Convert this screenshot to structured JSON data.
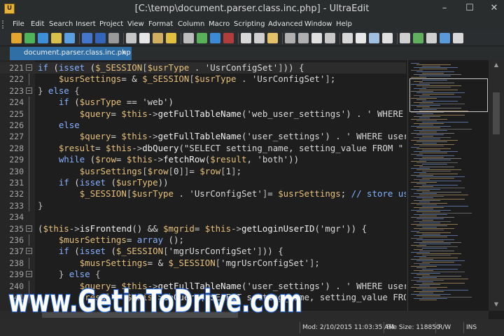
{
  "window": {
    "title": "[C:\\temp\\document.parser.class.inc.php] - UltraEdit",
    "minimize": "–",
    "maximize": "☐",
    "close": "✕"
  },
  "menu": [
    "File",
    "Edit",
    "Search",
    "Insert",
    "Project",
    "View",
    "Format",
    "Column",
    "Macro",
    "Scripting",
    "Advanced",
    "Window",
    "Help"
  ],
  "toolbar_icons": [
    "new-file-icon",
    "back-icon",
    "forward-icon",
    "folder-icon",
    "open-icon",
    "save-icon",
    "save-all-icon",
    "print-icon",
    "print-preview-icon",
    "settings-icon",
    "dictionary-icon",
    "column-mode-icon",
    "hex-icon",
    "ftp-icon",
    "globe-icon",
    "bookmark-icon",
    "cut-icon",
    "copy-icon",
    "paste-icon",
    "undo-icon",
    "redo-icon",
    "find-icon",
    "replace-icon",
    "find-files-icon",
    "zoom-icon",
    "list-icon",
    "window-icon",
    "compare-icon",
    "sync-icon",
    "theme-icon",
    "help-icon",
    "info-icon"
  ],
  "tabs": [
    {
      "label": "document.parser.class.inc.php",
      "close": "x"
    }
  ],
  "code": [
    {
      "n": "221",
      "fold": "-",
      "tokens": [
        [
          "k",
          "if"
        ],
        [
          "s",
          " ("
        ],
        [
          "k",
          "isset"
        ],
        [
          "s",
          " ("
        ],
        [
          "v",
          "$_SESSION"
        ],
        [
          "p",
          "["
        ],
        [
          "v",
          "$usrType"
        ],
        [
          "s",
          " . "
        ],
        [
          "s",
          "'UsrConfigSet'"
        ],
        [
          "p",
          "]"
        ],
        [
          "s",
          "))"
        ],
        [
          "s",
          " {"
        ]
      ]
    },
    {
      "n": "222",
      "fold": "|",
      "tokens": [
        [
          "s",
          "    "
        ],
        [
          "v",
          "$usrSettings"
        ],
        [
          "s",
          "= & "
        ],
        [
          "v",
          "$_SESSION"
        ],
        [
          "p",
          "["
        ],
        [
          "v",
          "$usrType"
        ],
        [
          "s",
          " . "
        ],
        [
          "s",
          "'UsrConfigSet'"
        ],
        [
          "p",
          "]"
        ],
        [
          "s",
          ";"
        ]
      ]
    },
    {
      "n": "223",
      "fold": "-",
      "tokens": [
        [
          "p",
          "} "
        ],
        [
          "k",
          "else"
        ],
        [
          "p",
          " {"
        ]
      ]
    },
    {
      "n": "224",
      "fold": "|",
      "tokens": [
        [
          "s",
          "    "
        ],
        [
          "k",
          "if"
        ],
        [
          "s",
          " ("
        ],
        [
          "v",
          "$usrType"
        ],
        [
          "s",
          " == "
        ],
        [
          "s",
          "'web'"
        ],
        [
          "s",
          ")"
        ]
      ]
    },
    {
      "n": "225",
      "fold": "|",
      "tokens": [
        [
          "s",
          "        "
        ],
        [
          "v",
          "$query"
        ],
        [
          "s",
          "= "
        ],
        [
          "v",
          "$this"
        ],
        [
          "p",
          "->"
        ],
        [
          "f",
          "getFullTableName"
        ],
        [
          "s",
          "("
        ],
        [
          "s",
          "'web_user_settings'"
        ],
        [
          "s",
          ") . "
        ],
        [
          "s",
          "' WHERE webus"
        ]
      ]
    },
    {
      "n": "226",
      "fold": "|",
      "tokens": [
        [
          "s",
          "    "
        ],
        [
          "k",
          "else"
        ]
      ]
    },
    {
      "n": "227",
      "fold": "|",
      "tokens": [
        [
          "s",
          "        "
        ],
        [
          "v",
          "$query"
        ],
        [
          "s",
          "= "
        ],
        [
          "v",
          "$this"
        ],
        [
          "p",
          "->"
        ],
        [
          "f",
          "getFullTableName"
        ],
        [
          "s",
          "("
        ],
        [
          "s",
          "'user_settings'"
        ],
        [
          "s",
          ") . "
        ],
        [
          "s",
          "' WHERE user=\\'"
        ]
      ]
    },
    {
      "n": "228",
      "fold": "|",
      "tokens": [
        [
          "s",
          "    "
        ],
        [
          "v",
          "$result"
        ],
        [
          "s",
          "= "
        ],
        [
          "v",
          "$this"
        ],
        [
          "p",
          "->"
        ],
        [
          "f",
          "dbQuery"
        ],
        [
          "s",
          "("
        ],
        [
          "s",
          "\"SELECT setting_name, setting_value FROM \""
        ],
        [
          "s",
          " . "
        ],
        [
          "v",
          "$qu"
        ]
      ]
    },
    {
      "n": "229",
      "fold": "|",
      "tokens": [
        [
          "s",
          "    "
        ],
        [
          "k",
          "while"
        ],
        [
          "s",
          " ("
        ],
        [
          "v",
          "$row"
        ],
        [
          "s",
          "= "
        ],
        [
          "v",
          "$this"
        ],
        [
          "p",
          "->"
        ],
        [
          "f",
          "fetchRow"
        ],
        [
          "s",
          "("
        ],
        [
          "v",
          "$result"
        ],
        [
          "s",
          ", "
        ],
        [
          "s",
          "'both'"
        ],
        [
          "s",
          "))"
        ]
      ]
    },
    {
      "n": "230",
      "fold": "|",
      "tokens": [
        [
          "s",
          "        "
        ],
        [
          "v",
          "$usrSettings"
        ],
        [
          "p",
          "["
        ],
        [
          "v",
          "$row"
        ],
        [
          "p",
          "["
        ],
        [
          "s",
          "0"
        ],
        [
          "p",
          "]]"
        ],
        [
          "s",
          "= "
        ],
        [
          "v",
          "$row"
        ],
        [
          "p",
          "["
        ],
        [
          "s",
          "1"
        ],
        [
          "p",
          "]"
        ],
        [
          "s",
          ";"
        ]
      ]
    },
    {
      "n": "231",
      "fold": "|",
      "tokens": [
        [
          "s",
          "    "
        ],
        [
          "k",
          "if"
        ],
        [
          "s",
          " ("
        ],
        [
          "k",
          "isset"
        ],
        [
          "s",
          " ("
        ],
        [
          "v",
          "$usrType"
        ],
        [
          "s",
          "))"
        ]
      ]
    },
    {
      "n": "232",
      "fold": "|",
      "tokens": [
        [
          "s",
          "        "
        ],
        [
          "v",
          "$_SESSION"
        ],
        [
          "p",
          "["
        ],
        [
          "v",
          "$usrType"
        ],
        [
          "s",
          " . "
        ],
        [
          "s",
          "'UsrConfigSet'"
        ],
        [
          "p",
          "]"
        ],
        [
          "s",
          "= "
        ],
        [
          "v",
          "$usrSettings"
        ],
        [
          "s",
          "; "
        ],
        [
          "c",
          "// store user se"
        ]
      ]
    },
    {
      "n": "233",
      "fold": "|",
      "tokens": [
        [
          "p",
          "}"
        ]
      ]
    },
    {
      "n": "234",
      "fold": "",
      "tokens": []
    },
    {
      "n": "235",
      "fold": "-",
      "tokens": [
        [
          "s",
          "("
        ],
        [
          "v",
          "$this"
        ],
        [
          "p",
          "->"
        ],
        [
          "f",
          "isFrontend"
        ],
        [
          "s",
          "() && "
        ],
        [
          "v",
          "$mgrid"
        ],
        [
          "s",
          "= "
        ],
        [
          "v",
          "$this"
        ],
        [
          "p",
          "->"
        ],
        [
          "f",
          "getLoginUserID"
        ],
        [
          "s",
          "("
        ],
        [
          "s",
          "'mgr'"
        ],
        [
          "s",
          ")) {"
        ]
      ]
    },
    {
      "n": "236",
      "fold": "|",
      "tokens": [
        [
          "s",
          "    "
        ],
        [
          "v",
          "$musrSettings"
        ],
        [
          "s",
          "= "
        ],
        [
          "k",
          "array"
        ],
        [
          "s",
          " ();"
        ]
      ]
    },
    {
      "n": "237",
      "fold": "-",
      "tokens": [
        [
          "s",
          "    "
        ],
        [
          "k",
          "if"
        ],
        [
          "s",
          " ("
        ],
        [
          "k",
          "isset"
        ],
        [
          "s",
          " ("
        ],
        [
          "v",
          "$_SESSION"
        ],
        [
          "p",
          "["
        ],
        [
          "s",
          "'mgrUsrConfigSet'"
        ],
        [
          "p",
          "]"
        ],
        [
          "s",
          ")) {"
        ]
      ]
    },
    {
      "n": "238",
      "fold": "|",
      "tokens": [
        [
          "s",
          "        "
        ],
        [
          "v",
          "$musrSettings"
        ],
        [
          "s",
          "= & "
        ],
        [
          "v",
          "$_SESSION"
        ],
        [
          "p",
          "["
        ],
        [
          "s",
          "'mgrUsrConfigSet'"
        ],
        [
          "p",
          "]"
        ],
        [
          "s",
          ";"
        ]
      ]
    },
    {
      "n": "239",
      "fold": "-",
      "tokens": [
        [
          "s",
          "    "
        ],
        [
          "p",
          "} "
        ],
        [
          "k",
          "else"
        ],
        [
          "p",
          " {"
        ]
      ]
    },
    {
      "n": "240",
      "fold": "|",
      "tokens": [
        [
          "s",
          "        "
        ],
        [
          "v",
          "$query"
        ],
        [
          "s",
          "= "
        ],
        [
          "v",
          "$this"
        ],
        [
          "p",
          "->"
        ],
        [
          "f",
          "getFullTableName"
        ],
        [
          "s",
          "("
        ],
        [
          "s",
          "'user_settings'"
        ],
        [
          "s",
          ") . "
        ],
        [
          "s",
          "' WHERE user=\\'"
        ],
        [
          "s",
          "' . "
        ],
        [
          "v",
          "$m"
        ]
      ]
    },
    {
      "n": "241",
      "fold": "|",
      "tokens": [
        [
          "s",
          "        "
        ],
        [
          "v",
          "$result"
        ],
        [
          "s",
          "= "
        ],
        [
          "v",
          "$this"
        ],
        [
          "p",
          "->"
        ],
        [
          "f",
          "dbQuery"
        ],
        [
          "s",
          "(\"SELECT setting_name, "
        ],
        [
          "s",
          "setting_value FROM \" . "
        ]
      ]
    }
  ],
  "status": {
    "modified": "Mod: 2/10/2015 11:03:35 AM",
    "file_size": "File Size: 118850",
    "mode": "R/W",
    "insert": "INS"
  },
  "watermark": {
    "text": "www.GetinToDrive.com"
  },
  "colors": {
    "keyword": "#86b0ff",
    "variable": "#e6c07b",
    "tab_active": "#2f6fa6",
    "watermark_fill": "#ffffff",
    "watermark_stroke": "#1d5fcf"
  }
}
